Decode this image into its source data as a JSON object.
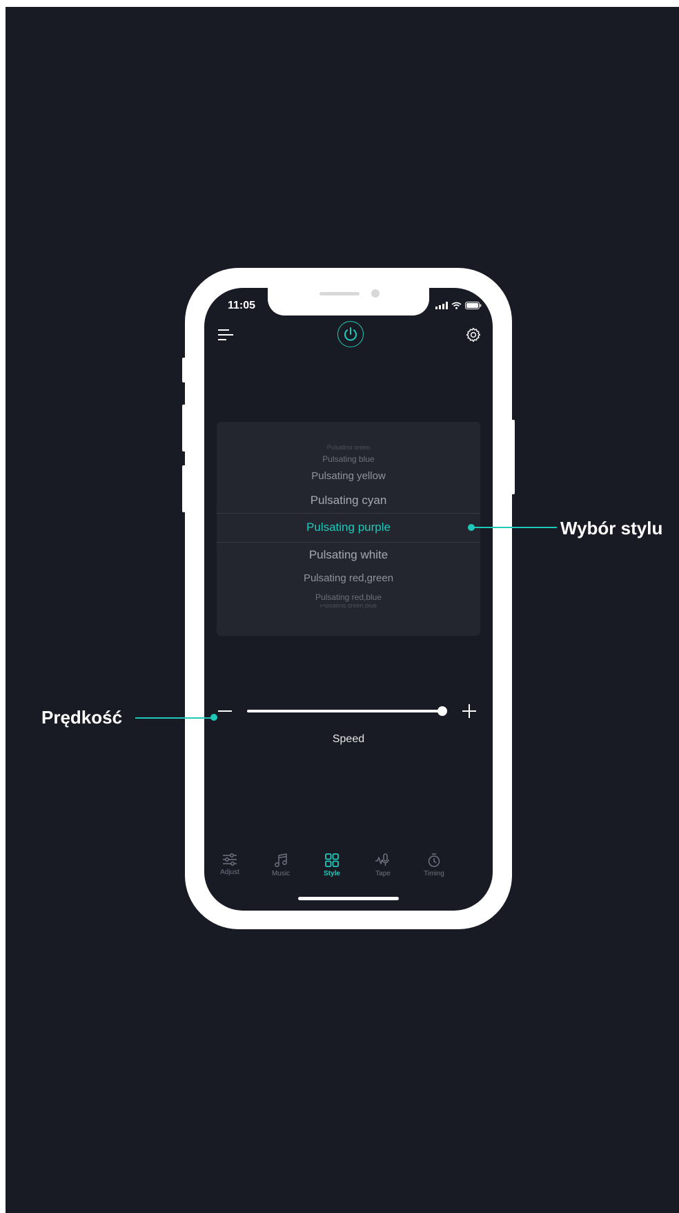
{
  "colors": {
    "accent": "#1fc9b9",
    "background": "#191b24",
    "inactive": "#6f7380"
  },
  "status_bar": {
    "time": "11:05"
  },
  "header": {
    "menu_icon": "menu-icon",
    "power_icon": "power-icon",
    "settings_icon": "gear-icon"
  },
  "style_picker": {
    "items": [
      "Pulsating green",
      "Pulsating blue",
      "Pulsating yellow",
      "Pulsating cyan",
      "Pulsating purple",
      "Pulsating white",
      "Pulsating red,green",
      "Pulsating red,blue",
      "Pulsating green,blue"
    ],
    "selected": "Pulsating purple"
  },
  "speed": {
    "label": "Speed",
    "value_fraction": 1.0
  },
  "tabs": [
    {
      "label": "Adjust",
      "icon": "sliders-icon",
      "active": false
    },
    {
      "label": "Music",
      "icon": "music-icon",
      "active": false
    },
    {
      "label": "Style",
      "icon": "grid-icon",
      "active": true
    },
    {
      "label": "Tape",
      "icon": "mic-wave-icon",
      "active": false
    },
    {
      "label": "Timing",
      "icon": "timer-icon",
      "active": false
    }
  ],
  "annotations": {
    "style_choice": "Wybór stylu",
    "speed": "Prędkość"
  }
}
